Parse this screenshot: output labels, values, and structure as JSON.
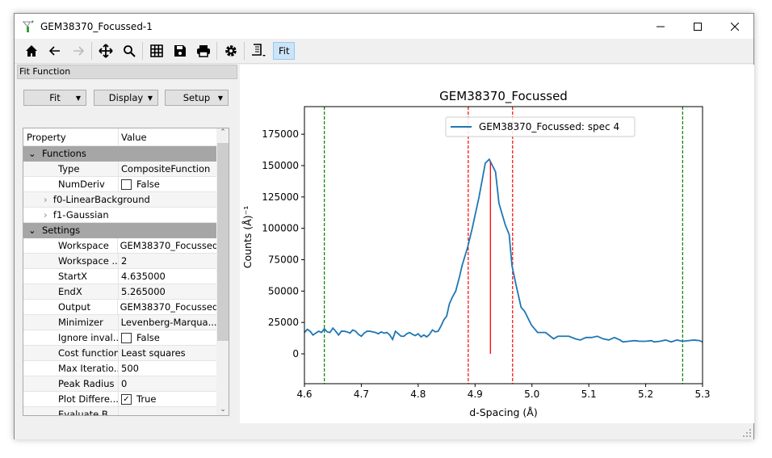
{
  "window": {
    "title": "GEM38370_Focussed-1",
    "controls": [
      "minimize",
      "maximize",
      "close"
    ]
  },
  "toolbar": {
    "icons": [
      "home-icon",
      "back-icon",
      "forward-icon",
      "pan-icon",
      "zoom-icon",
      "grid-icon",
      "save-icon",
      "print-icon",
      "settings-icon",
      "script-icon"
    ],
    "fit_label": "Fit",
    "active_color": "#cce4f7"
  },
  "fit_panel": {
    "header": "Fit Function",
    "buttons": [
      "Fit",
      "Display",
      "Setup"
    ],
    "table": {
      "col_property": "Property",
      "col_value": "Value",
      "groups": {
        "functions": "Functions",
        "settings": "Settings"
      },
      "functions": [
        {
          "k": "Type",
          "v": "CompositeFunction"
        },
        {
          "k": "NumDeriv",
          "v": "False",
          "check": false
        }
      ],
      "subfunctions": [
        "f0-LinearBackground",
        "f1-Gaussian"
      ],
      "settings": [
        {
          "k": "Workspace",
          "v": "GEM38370_Focussed"
        },
        {
          "k": "Workspace ...",
          "v": "2"
        },
        {
          "k": "StartX",
          "v": "4.635000"
        },
        {
          "k": "EndX",
          "v": "5.265000"
        },
        {
          "k": "Output",
          "v": "GEM38370_Focussed"
        },
        {
          "k": "Minimizer",
          "v": "Levenberg-Marqua..."
        },
        {
          "k": "Ignore inval...",
          "v": "False",
          "check": false
        },
        {
          "k": "Cost function",
          "v": "Least squares"
        },
        {
          "k": "Max Iteratio...",
          "v": "500"
        },
        {
          "k": "Peak Radius",
          "v": "0"
        },
        {
          "k": "Plot Differe...",
          "v": "True",
          "check": true
        },
        {
          "k": "Evaluate B...",
          "v": ""
        }
      ]
    }
  },
  "chart_data": {
    "type": "line",
    "title": "GEM38370_Focussed",
    "xlabel": "d-Spacing (Å)",
    "ylabel": "Counts (Å)⁻¹",
    "xlim": [
      4.6,
      5.3
    ],
    "ylim": [
      -23800,
      197000
    ],
    "xticks": [
      "4.6",
      "4.7",
      "4.8",
      "4.9",
      "5.0",
      "5.1",
      "5.2",
      "5.3"
    ],
    "yticks": [
      "0",
      "25000",
      "50000",
      "75000",
      "100000",
      "125000",
      "150000",
      "175000"
    ],
    "legend": {
      "position": "top-center",
      "entries": [
        "GEM38370_Focussed: spec 4"
      ]
    },
    "grid": false,
    "series": [
      {
        "name": "GEM38370_Focussed: spec 4",
        "color": "#1f77b4",
        "x": [
          4.6,
          4.605,
          4.61,
          4.615,
          4.62,
          4.625,
          4.63,
          4.635,
          4.64,
          4.645,
          4.65,
          4.655,
          4.66,
          4.665,
          4.67,
          4.675,
          4.68,
          4.685,
          4.69,
          4.695,
          4.7,
          4.705,
          4.71,
          4.715,
          4.72,
          4.725,
          4.73,
          4.735,
          4.74,
          4.745,
          4.75,
          4.755,
          4.76,
          4.765,
          4.77,
          4.775,
          4.78,
          4.785,
          4.79,
          4.795,
          4.8,
          4.805,
          4.81,
          4.815,
          4.82,
          4.825,
          4.83,
          4.835,
          4.84,
          4.845,
          4.85,
          4.855,
          4.86,
          4.866,
          4.873,
          4.877,
          4.887,
          4.895,
          4.907,
          4.918,
          4.925,
          4.936,
          4.942,
          4.953,
          4.96,
          4.965,
          4.972,
          4.981,
          4.987,
          4.999,
          5.01,
          5.024,
          5.038,
          5.046,
          5.065,
          5.076,
          5.085,
          5.095,
          5.105,
          5.115,
          5.125,
          5.135,
          5.145,
          5.155,
          5.16,
          5.17,
          5.18,
          5.19,
          5.2,
          5.21,
          5.215,
          5.225,
          5.235,
          5.245,
          5.255,
          5.265,
          5.275,
          5.285,
          5.295,
          5.3
        ],
        "y": [
          17000,
          19500,
          18000,
          15000,
          16500,
          18000,
          17000,
          20000,
          17500,
          17000,
          20500,
          18000,
          15000,
          18000,
          18000,
          17500,
          16500,
          19000,
          18000,
          15500,
          14000,
          16500,
          18000,
          18000,
          17500,
          17000,
          16000,
          17500,
          16500,
          17000,
          15000,
          11500,
          18000,
          16000,
          14000,
          14000,
          16000,
          17000,
          15500,
          14500,
          16000,
          13500,
          15000,
          13500,
          15500,
          19000,
          17500,
          18000,
          22000,
          27000,
          30000,
          40000,
          45000,
          50000,
          62000,
          70000,
          85000,
          100000,
          125000,
          152000,
          155000,
          145000,
          120000,
          103000,
          95000,
          70000,
          55000,
          37000,
          34000,
          23000,
          17000,
          17000,
          12000,
          14000,
          14000,
          12000,
          11000,
          13000,
          13000,
          14000,
          12000,
          11000,
          13000,
          11000,
          9500,
          10000,
          10500,
          10000,
          10000,
          10500,
          9500,
          10000,
          11000,
          9500,
          11000,
          10000,
          10500,
          11000,
          10500,
          9500
        ]
      }
    ],
    "vlines": [
      {
        "x": 4.635,
        "style": "dashed",
        "color": "#008000"
      },
      {
        "x": 5.265,
        "style": "dashed",
        "color": "#008000"
      },
      {
        "x": 4.888,
        "style": "dashed",
        "color": "#ff0000"
      },
      {
        "x": 4.966,
        "style": "dashed",
        "color": "#ff0000"
      }
    ],
    "peak_marker": {
      "x": 4.927,
      "y0": 0,
      "y1": 153000,
      "color": "#ff0000"
    }
  }
}
